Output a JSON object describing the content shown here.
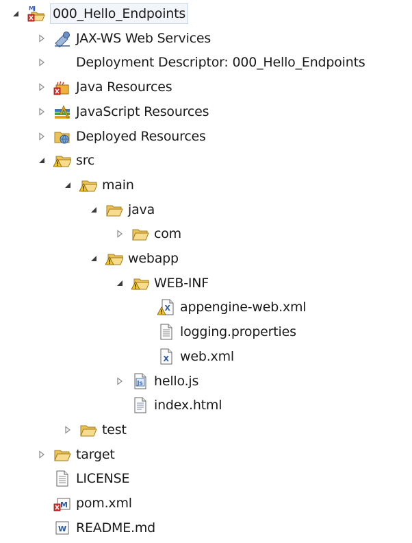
{
  "tree": {
    "items": [
      {
        "name": "root-project",
        "label": "000_Hello_Endpoints",
        "depth": 0,
        "toggle": "expanded",
        "icon": "maven-project-icon"
      },
      {
        "name": "jaxws-services",
        "label": "JAX-WS Web Services",
        "depth": 1,
        "toggle": "collapsed",
        "icon": "web-services-icon"
      },
      {
        "name": "deployment-descriptor",
        "label": "Deployment Descriptor: 000_Hello_Endpoints",
        "depth": 1,
        "toggle": "collapsed",
        "icon": ""
      },
      {
        "name": "java-resources",
        "label": "Java Resources",
        "depth": 1,
        "toggle": "collapsed",
        "icon": "java-resources-icon"
      },
      {
        "name": "javascript-resources",
        "label": "JavaScript Resources",
        "depth": 1,
        "toggle": "collapsed",
        "icon": "javascript-resources-icon"
      },
      {
        "name": "deployed-resources",
        "label": "Deployed Resources",
        "depth": 1,
        "toggle": "collapsed",
        "icon": "deployed-resources-icon"
      },
      {
        "name": "src",
        "label": "src",
        "depth": 1,
        "toggle": "expanded",
        "icon": "folder-warning-icon"
      },
      {
        "name": "main",
        "label": "main",
        "depth": 2,
        "toggle": "expanded",
        "icon": "folder-warning-icon"
      },
      {
        "name": "java",
        "label": "java",
        "depth": 3,
        "toggle": "expanded",
        "icon": "folder-open-icon"
      },
      {
        "name": "com",
        "label": "com",
        "depth": 4,
        "toggle": "collapsed",
        "icon": "folder-open-icon"
      },
      {
        "name": "webapp",
        "label": "webapp",
        "depth": 3,
        "toggle": "expanded",
        "icon": "folder-warning-icon"
      },
      {
        "name": "web-inf",
        "label": "WEB-INF",
        "depth": 4,
        "toggle": "expanded",
        "icon": "folder-warning-icon"
      },
      {
        "name": "appengine-web-xml",
        "label": "appengine-web.xml",
        "depth": 5,
        "toggle": "none",
        "icon": "xml-file-warning-icon"
      },
      {
        "name": "logging-properties",
        "label": "logging.properties",
        "depth": 5,
        "toggle": "none",
        "icon": "text-file-icon"
      },
      {
        "name": "web-xml",
        "label": "web.xml",
        "depth": 5,
        "toggle": "none",
        "icon": "xml-file-icon"
      },
      {
        "name": "hello-js",
        "label": "hello.js",
        "depth": 4,
        "toggle": "collapsed",
        "icon": "js-file-icon"
      },
      {
        "name": "index-html",
        "label": "index.html",
        "depth": 4,
        "toggle": "none",
        "icon": "html-file-icon"
      },
      {
        "name": "test",
        "label": "test",
        "depth": 2,
        "toggle": "collapsed",
        "icon": "folder-open-icon"
      },
      {
        "name": "target",
        "label": "target",
        "depth": 1,
        "toggle": "collapsed",
        "icon": "folder-open-icon"
      },
      {
        "name": "license",
        "label": "LICENSE",
        "depth": 1,
        "toggle": "none",
        "icon": "text-file-icon"
      },
      {
        "name": "pom-xml",
        "label": "pom.xml",
        "depth": 1,
        "toggle": "none",
        "icon": "maven-pom-error-icon"
      },
      {
        "name": "readme-md",
        "label": "README.md",
        "depth": 1,
        "toggle": "none",
        "icon": "word-file-icon"
      }
    ]
  }
}
